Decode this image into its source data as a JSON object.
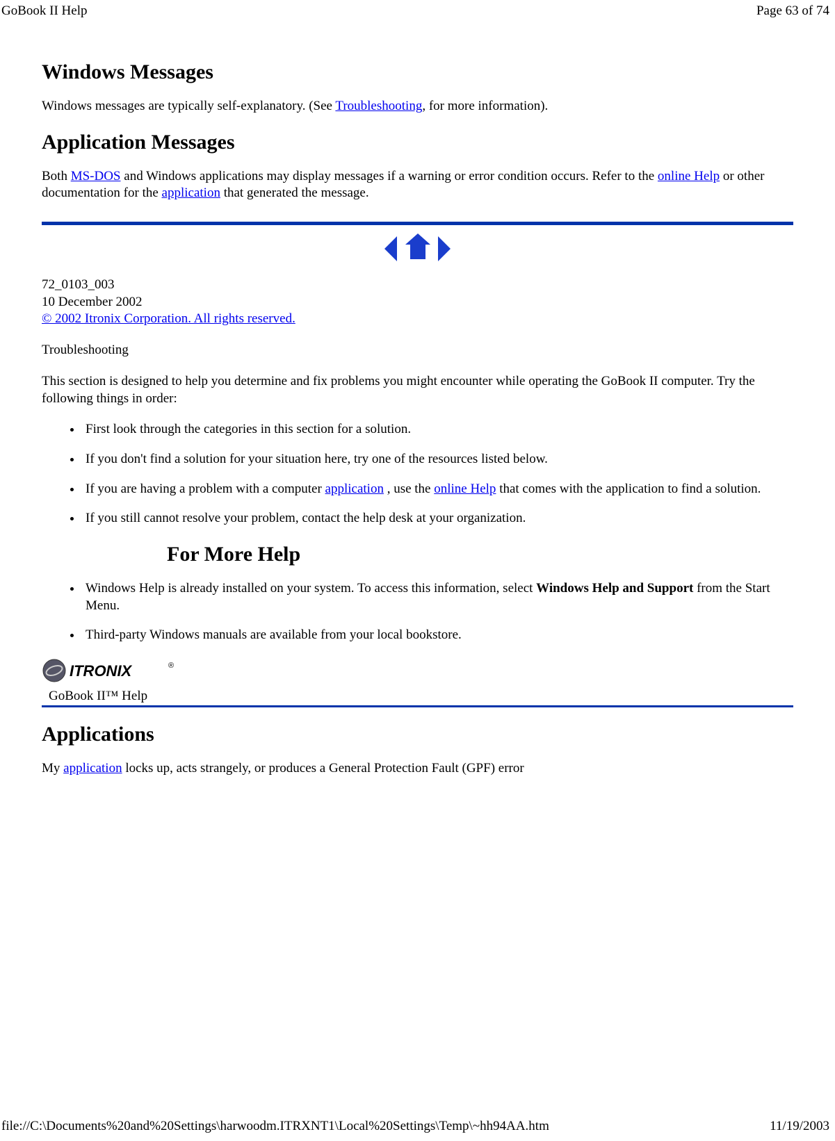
{
  "header": {
    "title": "GoBook II Help",
    "page_info": "Page 63 of 74"
  },
  "footer": {
    "path": "file://C:\\Documents%20and%20Settings\\harwoodm.ITRXNT1\\Local%20Settings\\Temp\\~hh94AA.htm",
    "date": "11/19/2003"
  },
  "sections": {
    "windows_messages": {
      "heading": "Windows Messages",
      "text_before_link": "Windows messages are typically self-explanatory. (See ",
      "link": "Troubleshooting",
      "text_after_link": ", for more information)."
    },
    "application_messages": {
      "heading": "Application Messages",
      "t1": "Both ",
      "l1": "MS-DOS",
      "t2": " and Windows applications may display messages if a warning or error condition occurs. Refer to the ",
      "l2": "online Help",
      "t3": " or other documentation for the ",
      "l3": "application",
      "t4": " that generated the message."
    },
    "doc_info": {
      "docnum": "72_0103_003",
      "date": "10 December 2002",
      "copyright": "© 2002 Itronix Corporation.  All rights reserved."
    },
    "troubleshooting": {
      "label": "Troubleshooting",
      "intro": "This section is designed to help you determine and fix problems you might encounter while operating the GoBook II computer. Try the following things in order:",
      "items": {
        "i1": "First look through the categories in this section for a solution.",
        "i2": "If you don't find a solution for your situation here, try one of the resources listed below.",
        "i3a": "If you are having a problem with a computer ",
        "i3l1": "application",
        "i3b": " , use the ",
        "i3l2": "online Help",
        "i3c": " that comes with the application to find a solution.",
        "i4": "If you still cannot resolve your problem, contact the help desk at your organization."
      }
    },
    "more_help": {
      "heading": "For More Help",
      "items": {
        "i1a": "Windows Help is already installed on your system.  To access this information, select ",
        "i1bold": "Windows Help and Support",
        "i1b": " from the Start Menu.",
        "i2": "Third-party Windows manuals are available from your local bookstore."
      }
    },
    "logo_section": {
      "logo_text": "ITRONIX",
      "help_label": "GoBook II™ Help"
    },
    "applications": {
      "heading": "Applications",
      "t1": "My ",
      "l1": "application",
      "t2": " locks up, acts strangely, or produces a General Protection Fault (GPF) error"
    }
  }
}
